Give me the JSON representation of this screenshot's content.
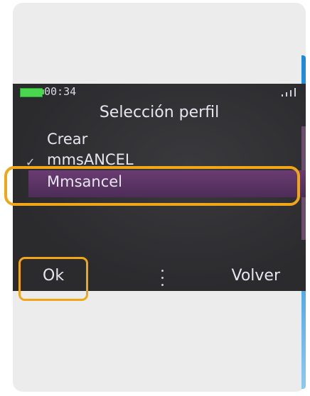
{
  "phone": {
    "status": {
      "time": "00:34",
      "battery_icon": "battery-icon",
      "signal_icon": "signal-icon"
    },
    "title": "Selección perfil",
    "menu": [
      {
        "label": "Crear",
        "checked": false,
        "selected": false
      },
      {
        "label": "mmsANCEL",
        "checked": true,
        "selected": false
      },
      {
        "label": "Mmsancel",
        "checked": false,
        "selected": true
      }
    ],
    "softkeys": {
      "left": "Ok",
      "right": "Volver"
    }
  },
  "colors": {
    "highlight": "#f0a616",
    "selection": "#6a3b72",
    "screen_bg": "#2e2e31",
    "battery": "#4bd650",
    "accent_edge": "#1f8ad8"
  }
}
